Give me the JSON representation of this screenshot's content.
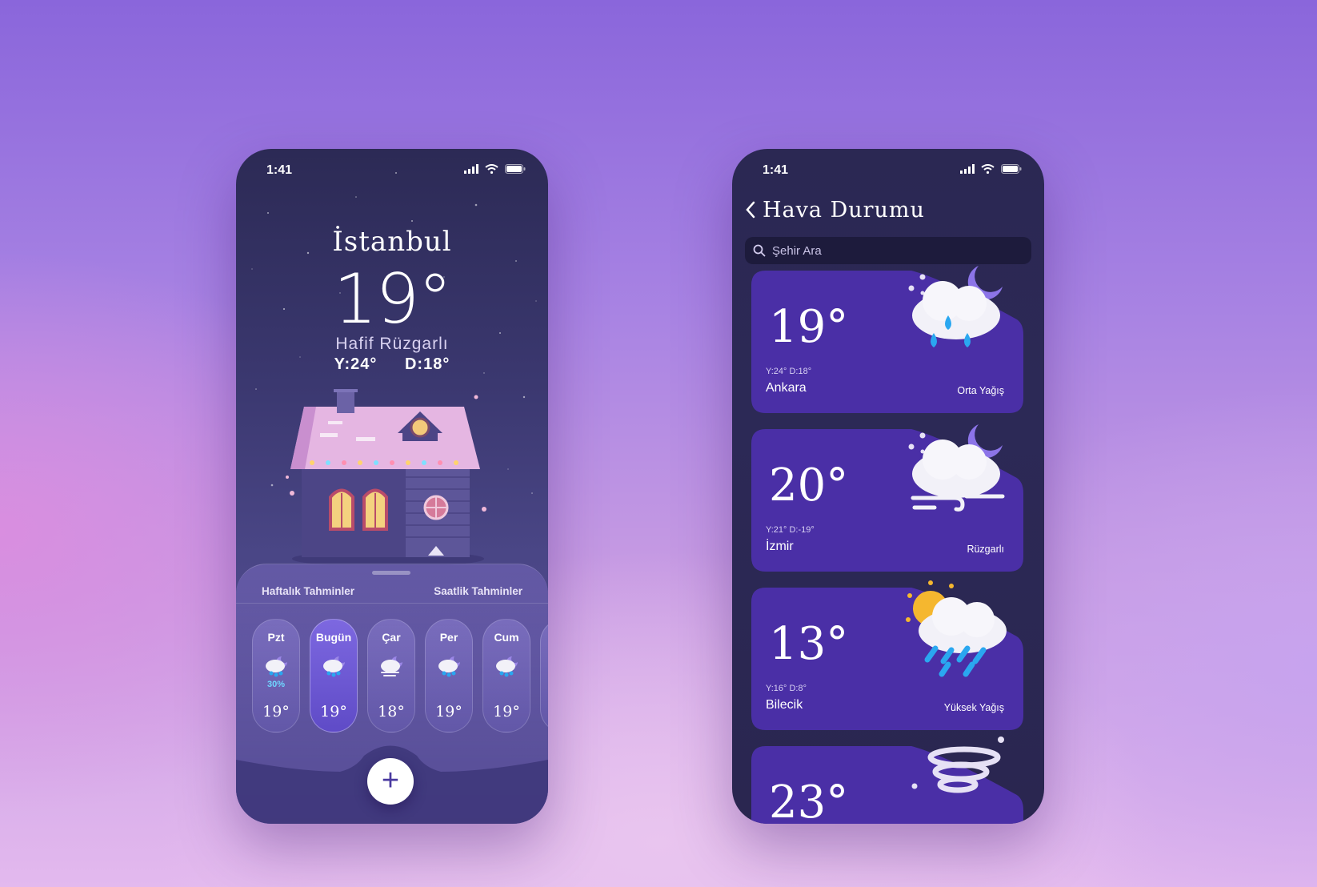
{
  "left_screen": {
    "status_time": "1:41",
    "city": "İstanbul",
    "temperature": "19°",
    "condition": "Hafif Rüzgarlı",
    "high": "Y:24°",
    "low": "D:18°",
    "tabs": {
      "weekly": "Haftalık Tahminler",
      "hourly": "Saatlik Tahminler"
    },
    "days": [
      {
        "name": "Pzt",
        "temp": "19°",
        "precip": "30%",
        "icon": "rain-cloud-moon-icon"
      },
      {
        "name": "Bugün",
        "temp": "19°",
        "icon": "rain-cloud-moon-icon",
        "active": true
      },
      {
        "name": "Çar",
        "temp": "18°",
        "icon": "wind-cloud-moon-icon"
      },
      {
        "name": "Per",
        "temp": "19°",
        "icon": "rain-cloud-moon-icon"
      },
      {
        "name": "Cum",
        "temp": "19°",
        "icon": "rain-cloud-moon-icon"
      }
    ],
    "add_button": "+"
  },
  "right_screen": {
    "status_time": "1:41",
    "title": "Hava Durumu",
    "search_placeholder": "Şehir Ara",
    "cities": [
      {
        "temp": "19°",
        "hilo": "Y:24°  D:18°",
        "name": "Ankara",
        "condition": "Orta Yağış",
        "icon": "rain-cloud-moon-icon"
      },
      {
        "temp": "20°",
        "hilo": "Y:21°  D:-19°",
        "name": "İzmir",
        "condition": "Rüzgarlı",
        "icon": "wind-cloud-moon-icon"
      },
      {
        "temp": "13°",
        "hilo": "Y:16°  D:8°",
        "name": "Bilecik",
        "condition": "Yüksek Yağış",
        "icon": "sun-heavy-rain-cloud-icon"
      },
      {
        "temp": "23°",
        "icon": "tornado-icon"
      }
    ]
  },
  "colors": {
    "accent": "#5f4bc7",
    "card": "#4a2fa6",
    "rain": "#2aa7f0"
  }
}
